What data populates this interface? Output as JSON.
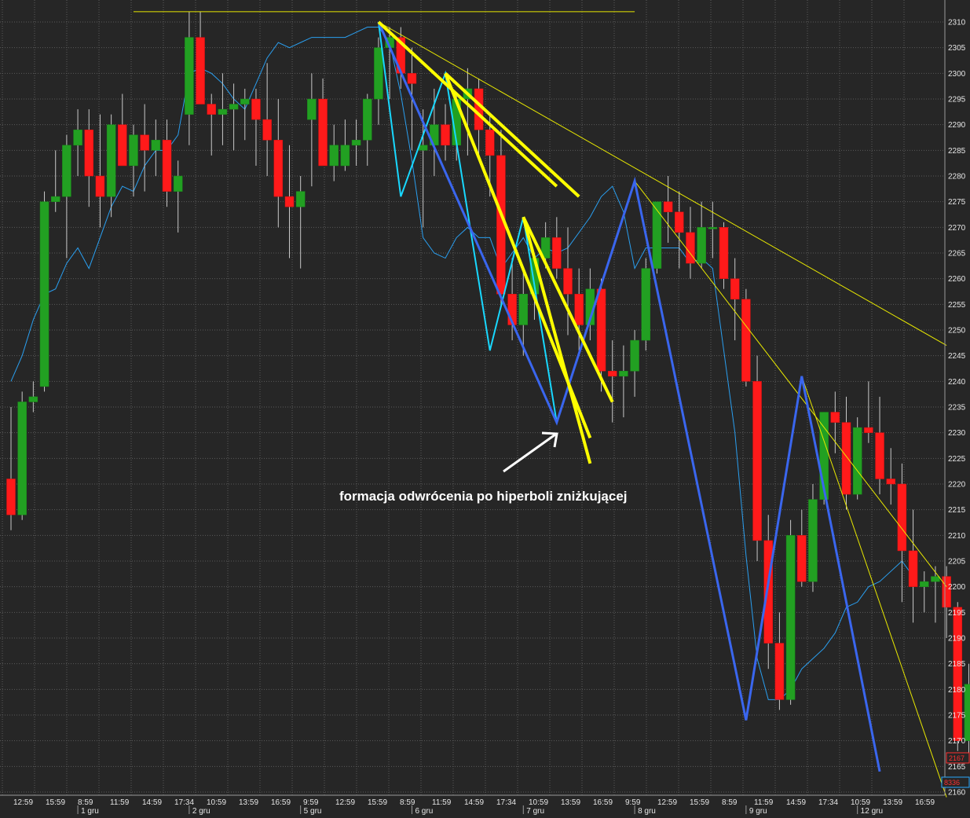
{
  "chart_data": {
    "type": "candlestick",
    "y_axis": {
      "position": "right",
      "ylim": [
        2158,
        2313
      ],
      "ticks": [
        2160,
        2165,
        2170,
        2175,
        2180,
        2185,
        2190,
        2195,
        2200,
        2205,
        2210,
        2215,
        2220,
        2225,
        2230,
        2235,
        2240,
        2245,
        2250,
        2255,
        2260,
        2265,
        2270,
        2275,
        2280,
        2285,
        2290,
        2295,
        2300,
        2305,
        2310
      ]
    },
    "x_axis": {
      "time_labels": [
        "12:59",
        "15:59",
        "8:59",
        "11:59",
        "14:59",
        "17:34",
        "10:59",
        "13:59",
        "16:59",
        "9:59",
        "12:59",
        "15:59",
        "8:59",
        "11:59",
        "14:59",
        "17:34",
        "10:59",
        "13:59",
        "16:59",
        "9:59",
        "12:59",
        "15:59",
        "8:59",
        "11:59",
        "14:59",
        "17:34",
        "10:59",
        "13:59",
        "16:59"
      ],
      "date_labels": [
        {
          "label": "1 gru",
          "index": 6
        },
        {
          "label": "2 gru",
          "index": 16
        },
        {
          "label": "5 gru",
          "index": 26
        },
        {
          "label": "6 gru",
          "index": 36
        },
        {
          "label": "7 gru",
          "index": 46
        },
        {
          "label": "8 gru",
          "index": 56
        },
        {
          "label": "9 gru",
          "index": 66
        },
        {
          "label": "12 gru",
          "index": 76
        }
      ]
    },
    "candles": [
      [
        2221,
        2235,
        2211,
        2214
      ],
      [
        2214,
        2238,
        2213,
        2236
      ],
      [
        2236,
        2240,
        2234,
        2237
      ],
      [
        2239,
        2277,
        2238,
        2275
      ],
      [
        2275,
        2285,
        2273,
        2276
      ],
      [
        2276,
        2288,
        2264,
        2286
      ],
      [
        2286,
        2293,
        2280,
        2289
      ],
      [
        2289,
        2293,
        2274,
        2280
      ],
      [
        2280,
        2292,
        2270,
        2276
      ],
      [
        2276,
        2292,
        2272,
        2290
      ],
      [
        2290,
        2296,
        2284,
        2282
      ],
      [
        2282,
        2290,
        2276,
        2288
      ],
      [
        2288,
        2294,
        2277,
        2285
      ],
      [
        2285,
        2291,
        2280,
        2287
      ],
      [
        2287,
        2291,
        2274,
        2277
      ],
      [
        2277,
        2283,
        2269,
        2280
      ],
      [
        2292,
        2312,
        2286,
        2307
      ],
      [
        2307,
        2312,
        2295,
        2294
      ],
      [
        2294,
        2296,
        2284,
        2292
      ],
      [
        2292,
        2300,
        2286,
        2293
      ],
      [
        2293,
        2298,
        2285,
        2294
      ],
      [
        2294,
        2297,
        2287,
        2295
      ],
      [
        2295,
        2297,
        2282,
        2291
      ],
      [
        2291,
        2302,
        2280,
        2287
      ],
      [
        2287,
        2295,
        2270,
        2276
      ],
      [
        2276,
        2286,
        2264,
        2274
      ],
      [
        2274,
        2280,
        2262,
        2277
      ],
      [
        2291,
        2300,
        2278,
        2295
      ],
      [
        2295,
        2299,
        2287,
        2282
      ],
      [
        2282,
        2290,
        2279,
        2286
      ],
      [
        2282,
        2291,
        2281,
        2286
      ],
      [
        2286,
        2291,
        2282,
        2287
      ],
      [
        2287,
        2296,
        2282,
        2295
      ],
      [
        2295,
        2307,
        2290,
        2305
      ],
      [
        2305,
        2309,
        2295,
        2307
      ],
      [
        2307,
        2309,
        2297,
        2300
      ],
      [
        2300,
        2305,
        2285,
        2298
      ],
      [
        2285,
        2293,
        2270,
        2286
      ],
      [
        2286,
        2297,
        2280,
        2290
      ],
      [
        2290,
        2294,
        2283,
        2286
      ],
      [
        2286,
        2296,
        2283,
        2295
      ],
      [
        2295,
        2301,
        2284,
        2297
      ],
      [
        2297,
        2299,
        2284,
        2289
      ],
      [
        2289,
        2292,
        2276,
        2284
      ],
      [
        2284,
        2289,
        2255,
        2257
      ],
      [
        2257,
        2264,
        2248,
        2251
      ],
      [
        2251,
        2262,
        2245,
        2257
      ],
      [
        2257,
        2264,
        2252,
        2264
      ],
      [
        2264,
        2271,
        2262,
        2268
      ],
      [
        2268,
        2272,
        2260,
        2262
      ],
      [
        2262,
        2270,
        2249,
        2257
      ],
      [
        2257,
        2262,
        2246,
        2251
      ],
      [
        2251,
        2262,
        2248,
        2258
      ],
      [
        2258,
        2260,
        2238,
        2242
      ],
      [
        2242,
        2248,
        2232,
        2241
      ],
      [
        2241,
        2247,
        2233,
        2242
      ],
      [
        2242,
        2250,
        2237,
        2248
      ],
      [
        2248,
        2264,
        2246,
        2262
      ],
      [
        2262,
        2274,
        2261,
        2275
      ],
      [
        2275,
        2280,
        2267,
        2273
      ],
      [
        2273,
        2277,
        2262,
        2269
      ],
      [
        2269,
        2274,
        2260,
        2263
      ],
      [
        2263,
        2275,
        2262,
        2270
      ],
      [
        2270,
        2275,
        2264,
        2270
      ],
      [
        2270,
        2271,
        2258,
        2260
      ],
      [
        2260,
        2264,
        2248,
        2256
      ],
      [
        2256,
        2258,
        2239,
        2240
      ],
      [
        2240,
        2245,
        2205,
        2209
      ],
      [
        2209,
        2214,
        2184,
        2189
      ],
      [
        2189,
        2195,
        2176,
        2178
      ],
      [
        2178,
        2213,
        2177,
        2210
      ],
      [
        2210,
        2215,
        2200,
        2201
      ],
      [
        2201,
        2220,
        2199,
        2217
      ],
      [
        2217,
        2234,
        2216,
        2234
      ],
      [
        2234,
        2238,
        2226,
        2232
      ],
      [
        2232,
        2237,
        2215,
        2218
      ],
      [
        2218,
        2233,
        2217,
        2231
      ],
      [
        2231,
        2240,
        2228,
        2230
      ],
      [
        2230,
        2237,
        2218,
        2221
      ],
      [
        2221,
        2227,
        2216,
        2220
      ],
      [
        2220,
        2224,
        2197,
        2207
      ],
      [
        2207,
        2215,
        2193,
        2200
      ],
      [
        2200,
        2203,
        2195,
        2201
      ],
      [
        2201,
        2204,
        2193,
        2202
      ],
      [
        2202,
        2204,
        2190,
        2196
      ],
      [
        2196,
        2197,
        2168,
        2170
      ],
      [
        2170,
        2185,
        2166,
        2181
      ],
      [
        2181,
        2184,
        2166,
        2167
      ]
    ],
    "ma_line": [
      2240,
      2245,
      2252,
      2257,
      2258,
      2263,
      2266,
      2262,
      2268,
      2274,
      2278,
      2277,
      2282,
      2285,
      2285,
      2288,
      2300,
      2301,
      2300,
      2298,
      2295,
      2293,
      2298,
      2303,
      2306,
      2305,
      2306,
      2307,
      2307,
      2307,
      2307,
      2308,
      2309,
      2309,
      2306,
      2296,
      2283,
      2268,
      2265,
      2264,
      2268,
      2270,
      2268,
      2268,
      2262,
      2265,
      2268,
      2264,
      2266,
      2265,
      2266,
      2269,
      2272,
      2276,
      2278,
      2273,
      2262,
      2266,
      2266,
      2266,
      2266,
      2263,
      2264,
      2262,
      2246,
      2230,
      2206,
      2186,
      2178,
      2178,
      2180,
      2184,
      2186,
      2188,
      2191,
      2196,
      2197,
      2200,
      2201,
      2203,
      2205,
      2202
    ],
    "zigzag_blue": [
      [
        33,
        2310
      ],
      [
        49,
        2232
      ],
      [
        56,
        2279
      ],
      [
        66,
        2174
      ],
      [
        71,
        2241
      ],
      [
        78,
        2164
      ]
    ],
    "zigzag_cyan": [
      [
        33,
        2310
      ],
      [
        35,
        2276
      ],
      [
        39,
        2300
      ],
      [
        43,
        2246
      ],
      [
        46,
        2272
      ],
      [
        49,
        2232
      ]
    ],
    "trendlines_yellow_thick": [
      {
        "from": [
          33,
          2310
        ],
        "to": [
          49,
          2278
        ]
      },
      {
        "from": [
          39,
          2300
        ],
        "to": [
          51,
          2276
        ]
      },
      {
        "from": [
          39,
          2300
        ],
        "to": [
          52,
          2229
        ]
      },
      {
        "from": [
          46,
          2272
        ],
        "to": [
          52,
          2224
        ]
      },
      {
        "from": [
          46,
          2272
        ],
        "to": [
          54,
          2236
        ]
      }
    ],
    "trendlines_yellow_thin": [
      {
        "from": [
          33,
          2310
        ],
        "to": [
          84,
          2247
        ]
      },
      {
        "from": [
          56,
          2279
        ],
        "to": [
          84,
          2200
        ]
      },
      {
        "from": [
          71,
          2241
        ],
        "to": [
          84,
          2159
        ]
      }
    ],
    "horizontal_line": {
      "y": 2312,
      "x_from": 11,
      "x_to": 56
    },
    "annotation": "formacja odwrócenia po hiperboli zniżkującej",
    "price_badges": [
      {
        "label": "2167",
        "color": "#ff3030"
      },
      {
        "label": "8336",
        "color": "#ff3030"
      }
    ]
  }
}
